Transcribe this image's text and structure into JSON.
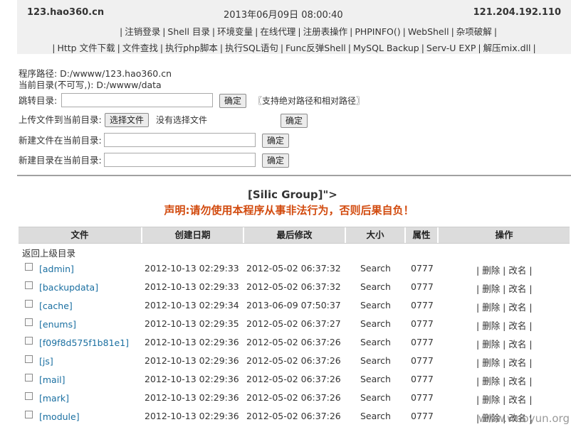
{
  "header": {
    "site": "123.hao360.cn",
    "datetime": "2013年06月09日 08:00:40",
    "ip": "121.204.192.110",
    "nav_row1": [
      "注销登录",
      "Shell 目录",
      "环境变量",
      "在线代理",
      "注册表操作",
      "PHPINFO()",
      "WebShell",
      "杂项破解"
    ],
    "nav_row2": [
      "Http 文件下载",
      "文件查找",
      "执行php脚本",
      "执行SQL语句",
      "Func反弹Shell",
      "MySQL Backup",
      "Serv-U EXP",
      "解压mix.dll"
    ]
  },
  "paths": {
    "program_path": "程序路径: D:/wwww/123.hao360.cn",
    "current_dir": "当前目录(不可写,): D:/wwww/data"
  },
  "forms": {
    "jump_label": "跳转目录:",
    "jump_value": "",
    "ok": "确定",
    "jump_note": "〖支持绝对路径和相对路径〗",
    "upload_label": "上传文件到当前目录:",
    "choose_file": "选择文件",
    "no_file": "没有选择文件",
    "newfile_label": "新建文件在当前目录:",
    "newdir_label": "新建目录在当前目录:"
  },
  "banner": {
    "title": "[Silic Group]\">",
    "notice": "声明:请勿使用本程序从事非法行为，否则后果自负！"
  },
  "table": {
    "headers": [
      "文件",
      "创建日期",
      "最后修改",
      "大小",
      "属性",
      "操作"
    ],
    "parent": "返回上级目录",
    "rows": [
      {
        "name": "[admin]",
        "created": "2012-10-13 02:29:33",
        "modified": "2012-05-02 06:37:32",
        "size": "Search",
        "attr": "0777",
        "delete": "删除",
        "rename": "改名"
      },
      {
        "name": "[backupdata]",
        "created": "2012-10-13 02:29:33",
        "modified": "2012-05-02 06:37:32",
        "size": "Search",
        "attr": "0777",
        "delete": "删除",
        "rename": "改名"
      },
      {
        "name": "[cache]",
        "created": "2012-10-13 02:29:34",
        "modified": "2013-06-09 07:50:37",
        "size": "Search",
        "attr": "0777",
        "delete": "删除",
        "rename": "改名"
      },
      {
        "name": "[enums]",
        "created": "2012-10-13 02:29:35",
        "modified": "2012-05-02 06:37:27",
        "size": "Search",
        "attr": "0777",
        "delete": "删除",
        "rename": "改名"
      },
      {
        "name": "[f09f8d575f1b81e1]",
        "created": "2012-10-13 02:29:36",
        "modified": "2012-05-02 06:37:26",
        "size": "Search",
        "attr": "0777",
        "delete": "删除",
        "rename": "改名"
      },
      {
        "name": "[js]",
        "created": "2012-10-13 02:29:36",
        "modified": "2012-05-02 06:37:26",
        "size": "Search",
        "attr": "0777",
        "delete": "删除",
        "rename": "改名"
      },
      {
        "name": "[mail]",
        "created": "2012-10-13 02:29:36",
        "modified": "2012-05-02 06:37:26",
        "size": "Search",
        "attr": "0777",
        "delete": "删除",
        "rename": "改名"
      },
      {
        "name": "[mark]",
        "created": "2012-10-13 02:29:36",
        "modified": "2012-05-02 06:37:26",
        "size": "Search",
        "attr": "0777",
        "delete": "删除",
        "rename": "改名"
      },
      {
        "name": "[module]",
        "created": "2012-10-13 02:29:36",
        "modified": "2012-05-02 06:37:26",
        "size": "Search",
        "attr": "0777",
        "delete": "删除",
        "rename": "改名"
      }
    ]
  },
  "watermark": "www.wooyun.org"
}
